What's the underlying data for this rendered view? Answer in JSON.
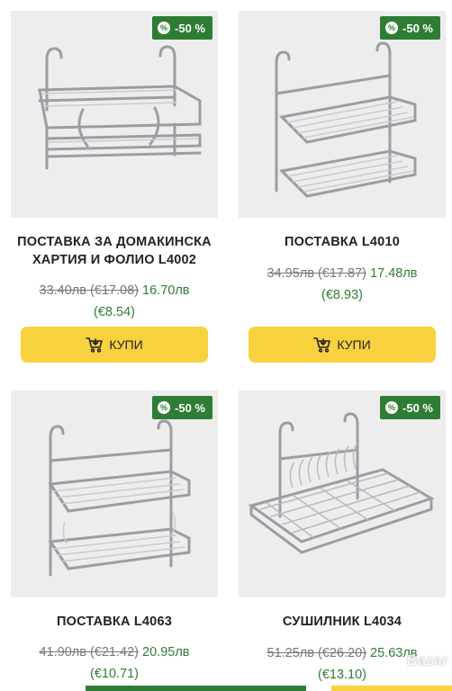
{
  "products": [
    {
      "badge": "-50 %",
      "badge_icon": "%",
      "title": "ПОСТАВКА ЗА ДОМАКИНСКА ХАРТИЯ И ФОЛИО L4002",
      "old_price": "33.40лв (€17.08)",
      "new_price": "16.70лв",
      "eur_price": "(€8.54)",
      "buy_label": "КУПИ",
      "image": "paper-towel-foil-holder-rack"
    },
    {
      "badge": "-50 %",
      "badge_icon": "%",
      "title": "ПОСТАВКА L4010",
      "old_price": "34.95лв (€17.87)",
      "new_price": "17.48лв",
      "eur_price": "(€8.93)",
      "buy_label": "КУПИ",
      "image": "two-tier-hanging-rack"
    },
    {
      "badge": "-50 %",
      "badge_icon": "%",
      "title": "ПОСТАВКА L4063",
      "old_price": "41.90лв (€21.42)",
      "new_price": "20.95лв",
      "eur_price": "(€10.71)",
      "buy_label": "КУПИ",
      "image": "two-tier-hanging-rack"
    },
    {
      "badge": "-50 %",
      "badge_icon": "%",
      "title": "СУШИЛНИК L4034",
      "old_price": "51.25лв (€26.20)",
      "new_price": "25.63лв",
      "eur_price": "(€13.10)",
      "buy_label": "КУПИ",
      "image": "dish-drying-rack"
    }
  ],
  "watermark": "Bazar",
  "colors": {
    "accent_green": "#2f7d34",
    "buy_yellow": "#f8d23e",
    "image_bg": "#ededee"
  }
}
